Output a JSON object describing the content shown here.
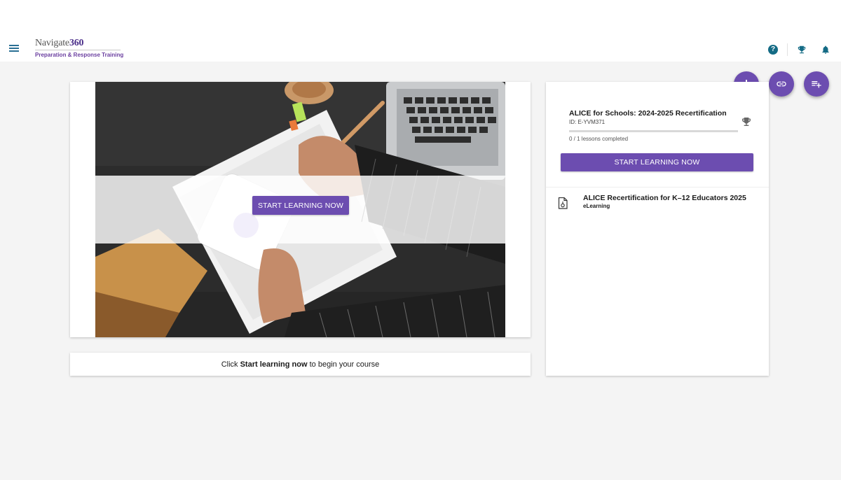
{
  "header": {
    "logo_name": "Navigate",
    "logo_number": "360",
    "logo_subtitle": "Preparation & Response Training",
    "icons": [
      "menu-icon",
      "help-icon",
      "trophy-icon",
      "bell-icon"
    ],
    "help_glyph": "?"
  },
  "fabs": [
    "cursor-icon",
    "link-icon",
    "playlist-add-icon"
  ],
  "hero": {
    "button_label": "START LEARNING NOW"
  },
  "message": {
    "before": "Click ",
    "emphasis": "Start learning now",
    "after": " to begin your course"
  },
  "course": {
    "title": "ALICE for Schools: 2024-2025 Recertification",
    "id": "ID: E-YVM371",
    "progress_text": "0 / 1 lessons completed",
    "progress_fraction": 0,
    "button_label": "START LEARNING NOW"
  },
  "lessons": [
    {
      "title": "ALICE Recertification for K–12 Educators 2025",
      "type": "eLearning",
      "icon": "elearning-doc-icon"
    }
  ],
  "colors": {
    "primary": "#6c4db0",
    "header_icon": "#146b85",
    "brand": "#4b2f8a",
    "background": "#f4f4f4"
  }
}
